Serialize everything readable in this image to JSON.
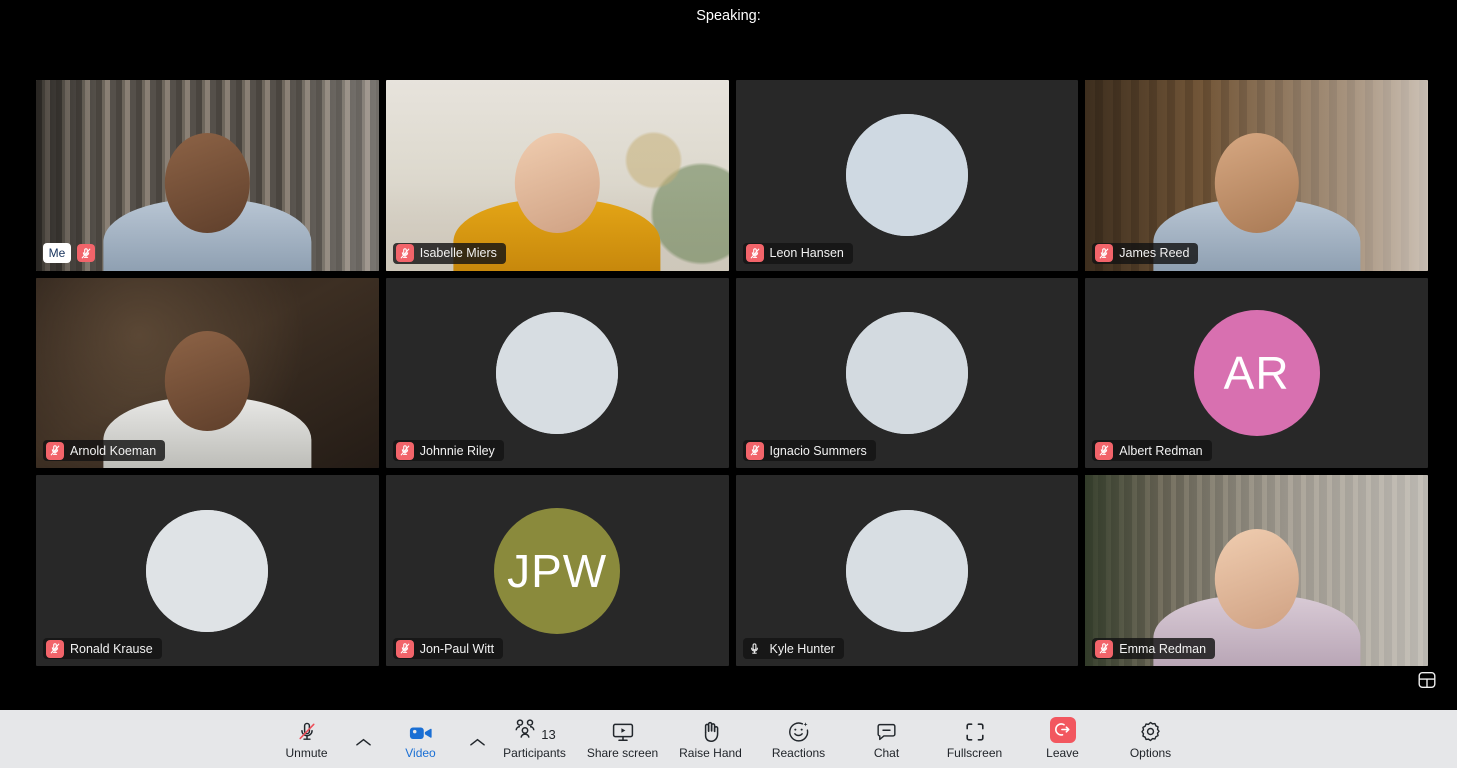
{
  "header": {
    "speaking_label": "Speaking:"
  },
  "self_badge": {
    "label": "Me"
  },
  "tiles": [
    {
      "name": "",
      "is_me": true,
      "me_label": "Me",
      "muted": true,
      "kind": "video",
      "feed": "feed-bookshelf",
      "skin": "skin-dark",
      "shirt": "shirt-blue"
    },
    {
      "name": "Isabelle Miers",
      "muted": true,
      "kind": "video",
      "feed": "feed-livingroom",
      "skin": "skin-light",
      "shirt": "shirt-mustard"
    },
    {
      "name": "Leon Hansen",
      "muted": true,
      "kind": "photo",
      "avatar_bg": "#cfd9e2",
      "skin": "skin-light",
      "shirt": "shirt-navy"
    },
    {
      "name": "James Reed",
      "muted": true,
      "kind": "video",
      "feed": "feed-office",
      "skin": "skin-mid",
      "shirt": "shirt-blue"
    },
    {
      "name": "Arnold Koeman",
      "muted": true,
      "kind": "video",
      "feed": "feed-cafe",
      "skin": "skin-dark",
      "shirt": "shirt-white"
    },
    {
      "name": "Johnnie Riley",
      "muted": true,
      "kind": "photo",
      "avatar_bg": "#d7dde2",
      "skin": "skin-light",
      "shirt": "shirt-navy"
    },
    {
      "name": "Ignacio Summers",
      "muted": true,
      "kind": "photo",
      "avatar_bg": "#d3dae0",
      "skin": "skin-light",
      "shirt": "shirt-blue"
    },
    {
      "name": "Albert Redman",
      "muted": true,
      "kind": "initials",
      "initials": "AR",
      "avatar_color": "#d870b0"
    },
    {
      "name": "Ronald Krause",
      "muted": true,
      "kind": "photo",
      "avatar_bg": "#dfe3e6",
      "skin": "skin-light",
      "shirt": "shirt-white"
    },
    {
      "name": "Jon-Paul Witt",
      "muted": true,
      "kind": "initials",
      "initials": "JPW",
      "avatar_color": "#8a8a3c"
    },
    {
      "name": "Kyle Hunter",
      "muted": false,
      "kind": "photo",
      "avatar_bg": "#d8dee3",
      "skin": "skin-light",
      "shirt": "shirt-blue"
    },
    {
      "name": "Emma Redman",
      "muted": true,
      "kind": "video",
      "feed": "feed-plantroom",
      "skin": "skin-light",
      "shirt": "shirt-pink"
    }
  ],
  "toolbar": {
    "unmute": {
      "label": "Unmute",
      "icon": "mic-muted-icon"
    },
    "mic_caret": {
      "icon": "chevron-up-icon"
    },
    "video": {
      "label": "Video",
      "icon": "camera-icon",
      "color": "#1a6fd4"
    },
    "video_caret": {
      "icon": "chevron-up-icon"
    },
    "participants": {
      "label": "Participants",
      "count": "13",
      "icon": "people-icon"
    },
    "share_screen": {
      "label": "Share screen",
      "icon": "screen-share-icon"
    },
    "raise_hand": {
      "label": "Raise Hand",
      "icon": "hand-icon"
    },
    "reactions": {
      "label": "Reactions",
      "icon": "smiley-icon"
    },
    "chat": {
      "label": "Chat",
      "icon": "chat-bubble-icon"
    },
    "fullscreen": {
      "label": "Fullscreen",
      "icon": "fullscreen-icon"
    },
    "leave": {
      "label": "Leave",
      "icon": "leave-arrow-icon",
      "color": "#f2575f"
    },
    "options": {
      "label": "Options",
      "icon": "gear-icon"
    }
  },
  "layout_toggle": {
    "icon": "grid-layout-icon"
  }
}
